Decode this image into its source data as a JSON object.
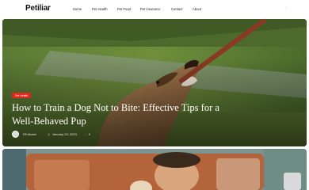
{
  "header": {
    "logo": "Petiliar",
    "nav": [
      "Home",
      "Pet Health",
      "Pet Food",
      "Pet insurance",
      "Contact",
      "About"
    ],
    "menu_icon": "dots-icon"
  },
  "hero": {
    "badge": "Pet Health",
    "title": "How to Train a Dog Not to Bite: Effective Tips for a Well-Behaved Pup",
    "author": "PA Akash",
    "date": "January 23, 2023",
    "comments": "0"
  },
  "colors": {
    "badge": "#e1261c",
    "title_text": "#ffffff",
    "text_dark": "#111111"
  }
}
